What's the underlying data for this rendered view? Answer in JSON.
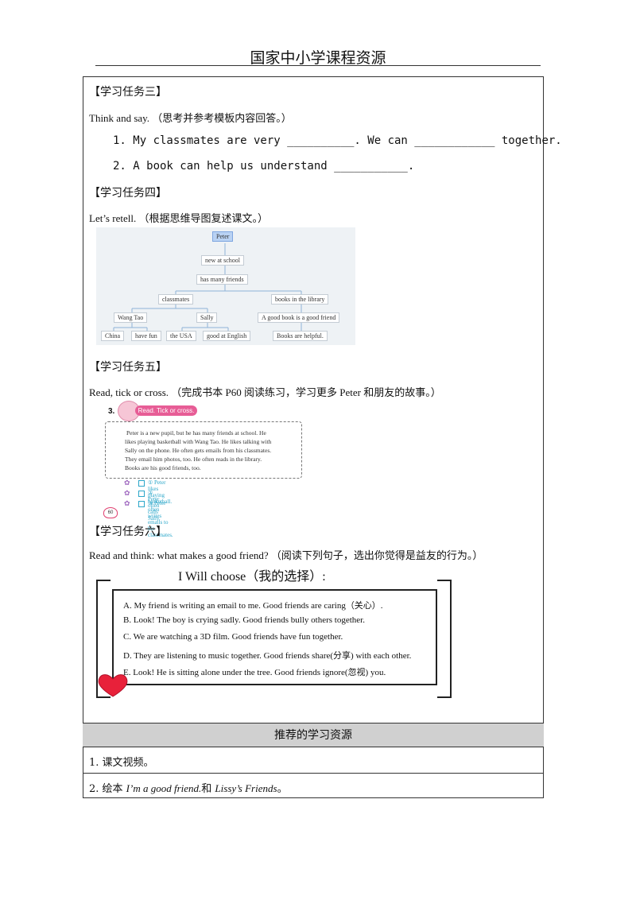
{
  "header": {
    "title": "国家中小学课程资源"
  },
  "task3": {
    "heading": "【学习任务三】",
    "instruction": "Think and say. （思考并参考模板内容回答。）",
    "q1": "1. My classmates are very __________. We can ____________ together.",
    "q2": "2. A book can help us understand ___________."
  },
  "task4": {
    "heading": "【学习任务四】",
    "instruction": "Let’s retell. （根据思维导图复述课文。）",
    "mindmap": {
      "root": "Peter",
      "n1": "new at school",
      "n2": "has many friends",
      "classmates": "classmates",
      "library": "books in the library",
      "wangtao": "Wang Tao",
      "sally": "Sally",
      "goodbook": "A good book is a good friend",
      "china": "China",
      "havefun": "have fun",
      "usa": "the USA",
      "english": "good at English",
      "helpful": "Books are helpful."
    }
  },
  "task5": {
    "heading": "【学习任务五】",
    "instruction": "Read, tick or cross. （完成书本 P60 阅读练习，学习更多 Peter 和朋友的故事。）",
    "exercise_number": "3.",
    "exercise_label": "Read. Tick or cross.",
    "passage": [
      "Peter is a new pupil, but he has many friends at school. He",
      "likes playing basketball with Wang Tao. He likes talking with",
      "Sally on the phone. He often gets emails from his classmates.",
      "They email him photos, too. He often reads in the library.",
      "Books are his good friends, too."
    ],
    "statements": [
      "① Peter likes playing basketball.",
      "② Peter often calls Sally.",
      "③ Peter often writes emails to his classmates."
    ],
    "page_number": "60"
  },
  "task6": {
    "heading": "【学习任务六】",
    "instruction": "Read and think: what makes a good friend? （阅读下列句子，选出你觉得是益友的行为。）",
    "choose_title": "I Will choose（我的选择）:",
    "choices": [
      "A.  My friend is writing an email to me. Good friends are caring（关心）.",
      "B.  Look! The boy is crying sadly. Good friends bully others together.",
      "C.  We are watching a 3D film. Good friends have fun together.",
      "D.  They are listening to music together. Good friends share(分享) with each other.",
      "E.  Look! He is sitting alone under the tree. Good friends ignore(忽视) you."
    ]
  },
  "resources": {
    "heading": "推荐的学习资源",
    "item1": "1. 课文视频。",
    "item2_prefix": "2. 绘本 ",
    "item2_book1": "I’m a good friend.",
    "item2_mid": "和 ",
    "item2_book2": "Lissy’s Friends",
    "item2_suffix": "。"
  },
  "colors": {
    "accent_pink": "#e75d96",
    "statement_blue": "#2aa6c9",
    "heart_red": "#e8213a"
  },
  "icons": [
    "flower-icon",
    "heart-icon",
    "checkbox-icon"
  ]
}
